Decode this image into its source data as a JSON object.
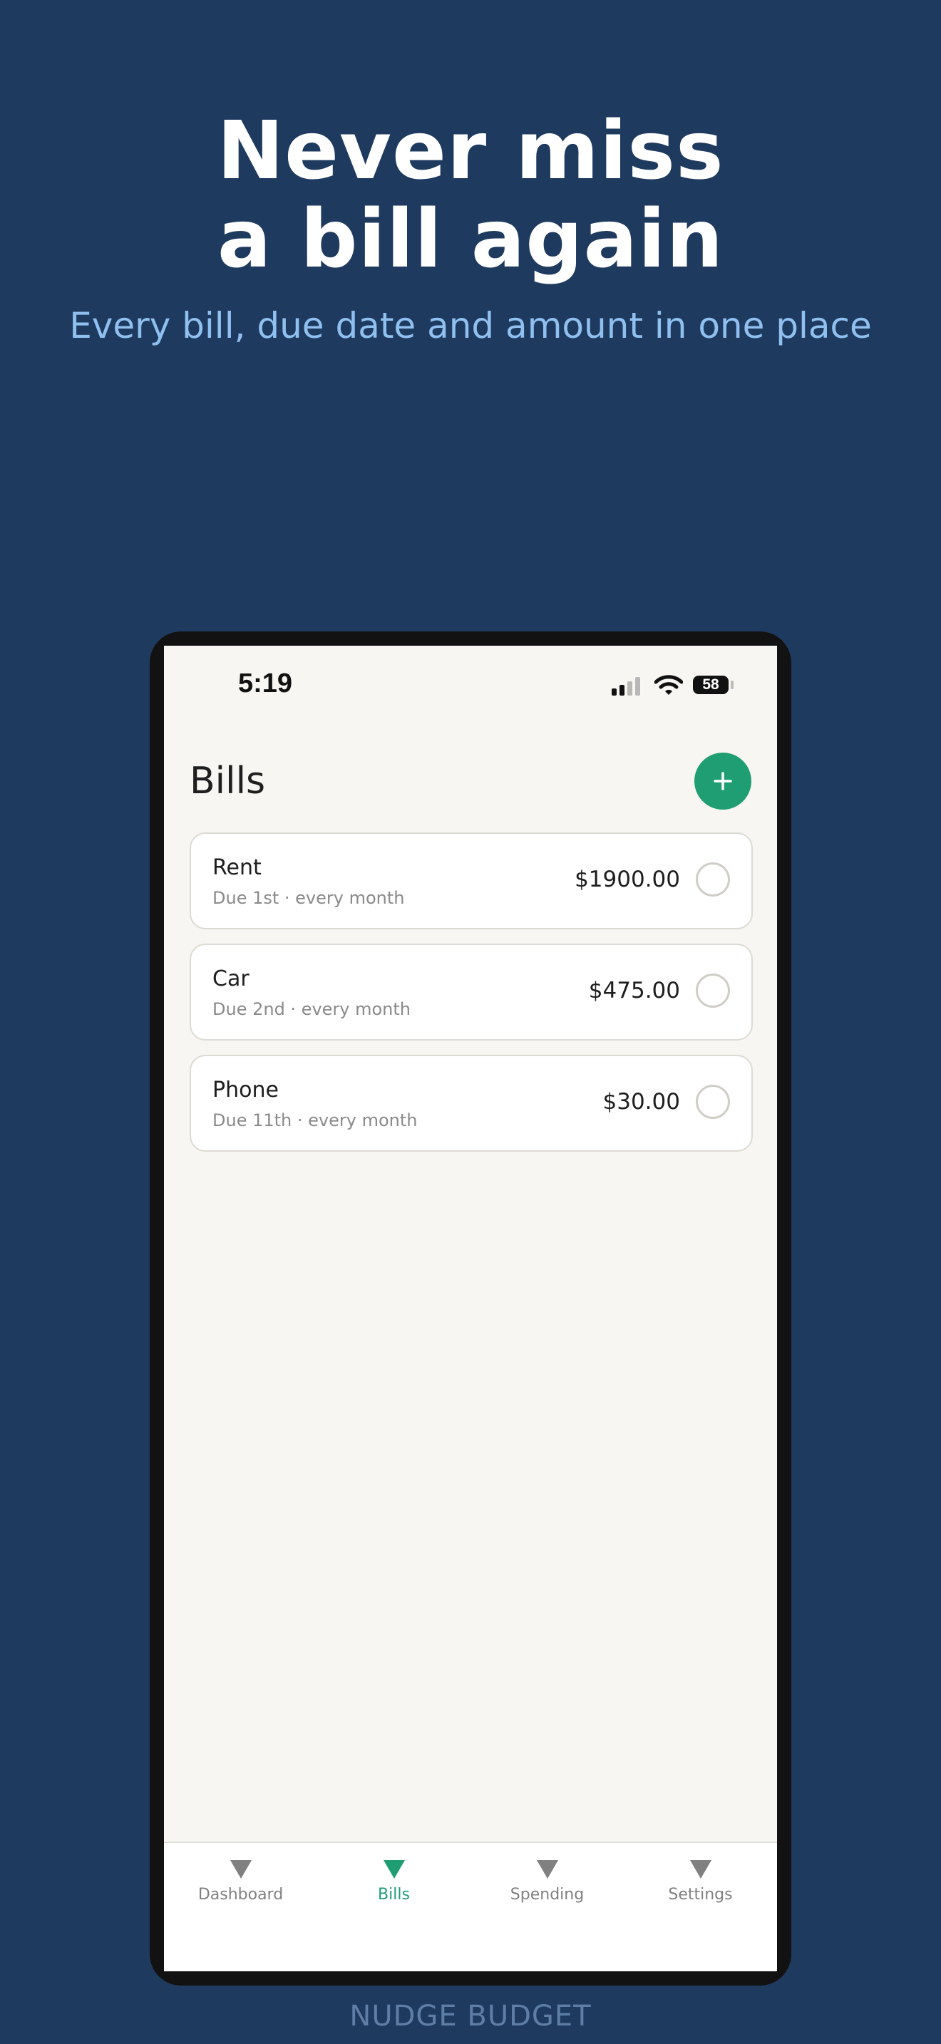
{
  "promo": {
    "headline_line1": "Never miss",
    "headline_line2": "a bill again",
    "subheadline": "Every bill, due date and amount in one place",
    "brand": "NUDGE BUDGET"
  },
  "status_bar": {
    "time": "5:19",
    "battery": "58",
    "icons": [
      "signal-icon",
      "wifi-icon",
      "battery-icon"
    ]
  },
  "screen": {
    "title": "Bills",
    "add_icon": "plus-icon"
  },
  "bills": [
    {
      "name": "Rent",
      "meta": "Due 1st · every month",
      "amount": "$1900.00",
      "paid": false
    },
    {
      "name": "Car",
      "meta": "Due 2nd · every month",
      "amount": "$475.00",
      "paid": false
    },
    {
      "name": "Phone",
      "meta": "Due 11th · every month",
      "amount": "$30.00",
      "paid": false
    }
  ],
  "tabs": [
    {
      "label": "Dashboard",
      "icon": "triangle-down-icon",
      "active": false
    },
    {
      "label": "Bills",
      "icon": "triangle-down-icon",
      "active": true
    },
    {
      "label": "Spending",
      "icon": "triangle-down-icon",
      "active": false
    },
    {
      "label": "Settings",
      "icon": "triangle-down-icon",
      "active": false
    }
  ],
  "colors": {
    "background": "#1f3a5f",
    "accent": "#1f9e74",
    "subheadline": "#8fc0f0"
  }
}
